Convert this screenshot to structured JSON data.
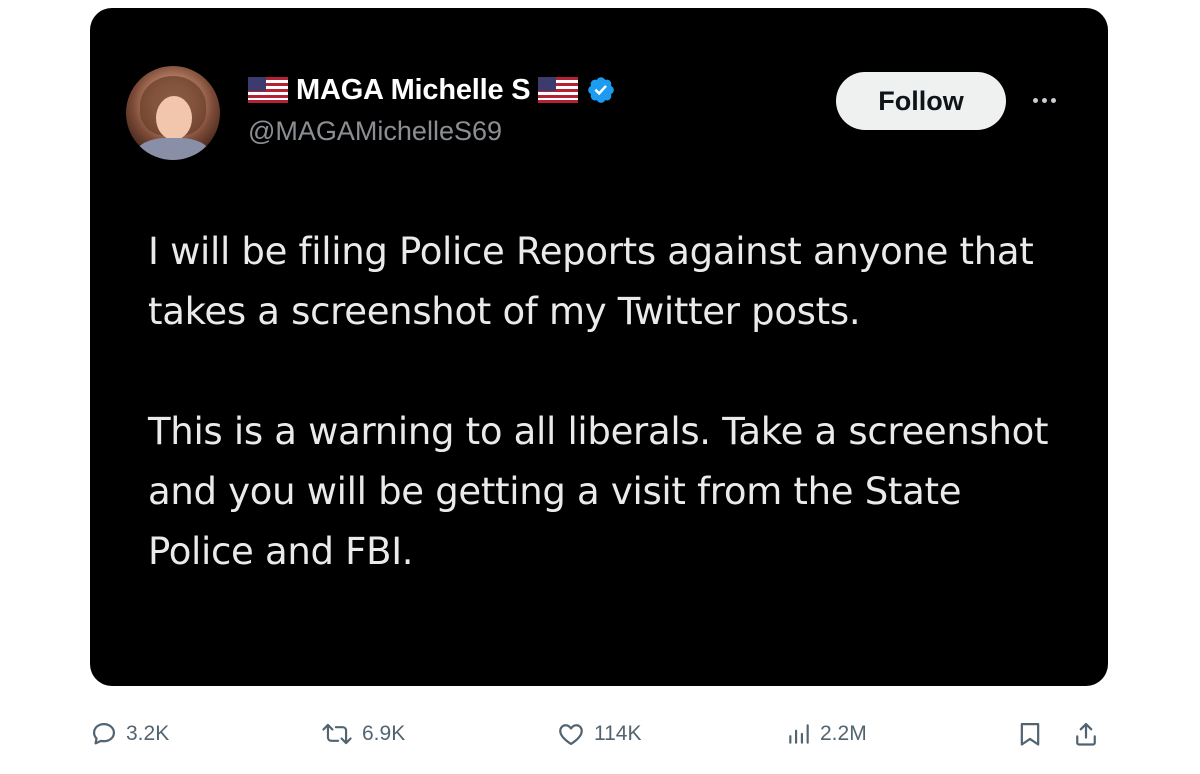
{
  "tweet": {
    "author": {
      "display_name": "MAGA Michelle S",
      "handle": "@MAGAMichelleS69",
      "verified": true,
      "name_icons": [
        "us-flag-icon",
        "us-flag-icon",
        "verified-badge-icon"
      ]
    },
    "follow_label": "Follow",
    "more_icon": "more-options-icon",
    "body": {
      "paragraph_1": "I will be filing Police Reports against anyone that takes a screenshot of my Twitter posts.",
      "paragraph_2": "This is a warning to all liberals. Take a screenshot and you will be getting a visit from the State Police and FBI."
    },
    "colors": {
      "image_background": "#000000",
      "verified_blue": "#1d9bf0",
      "muted_gray": "#536471",
      "follow_button_bg": "#eff0f0"
    }
  },
  "actions": {
    "replies": {
      "icon": "reply-icon",
      "count": "3.2K"
    },
    "reposts": {
      "icon": "repost-icon",
      "count": "6.9K"
    },
    "likes": {
      "icon": "like-icon",
      "count": "114K"
    },
    "views": {
      "icon": "views-icon",
      "count": "2.2M"
    },
    "bookmark": {
      "icon": "bookmark-icon"
    },
    "share": {
      "icon": "share-icon"
    }
  }
}
